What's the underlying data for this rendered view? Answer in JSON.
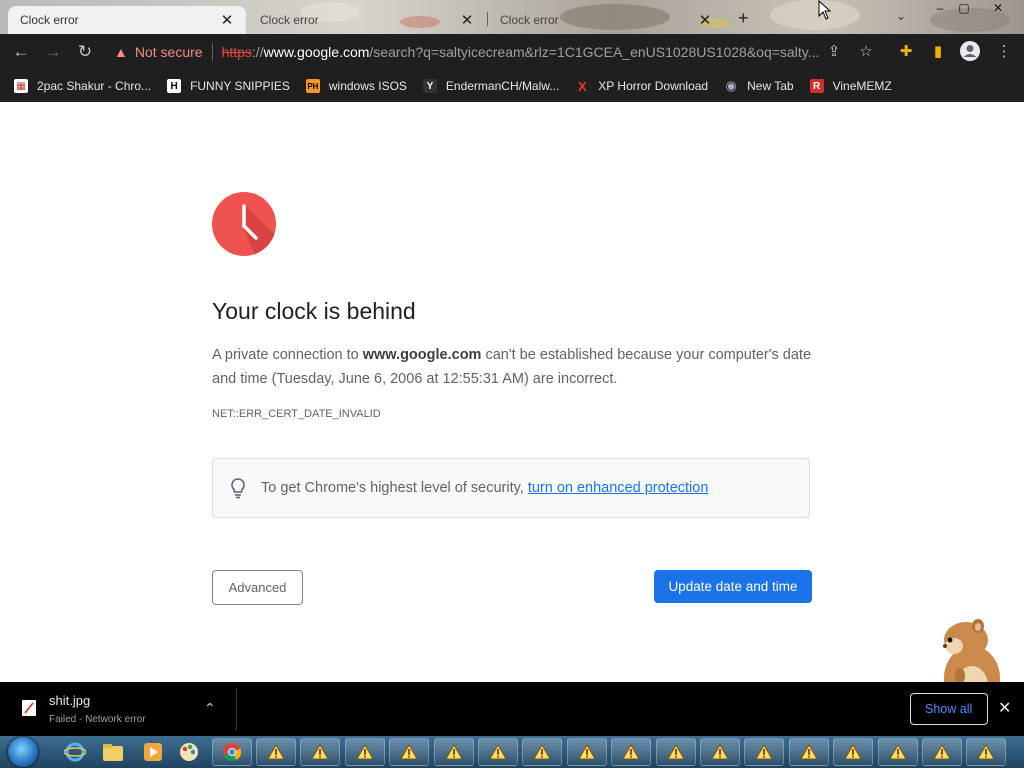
{
  "tabs": [
    {
      "title": "Clock error",
      "active": true,
      "close": "✕"
    },
    {
      "title": "Clock error",
      "active": false,
      "close": "✕"
    },
    {
      "title": "Clock error",
      "active": false,
      "close": "✕"
    }
  ],
  "new_tab_symbol": "+",
  "tab_search_symbol": "⌄",
  "window_controls": {
    "minimize": "‒",
    "maximize": "▢",
    "close": "✕"
  },
  "toolbar": {
    "back_icon": "←",
    "forward_icon": "→",
    "reload_icon": "↻",
    "warning_icon": "▲",
    "security_label": "Not secure",
    "url_scheme": "https",
    "url_slashes": "://",
    "url_host": "www.google.com",
    "url_path": "/search?q=saltyicecream&rlz=1C1GCEA_enUS1028US1028&oq=salty...",
    "share_icon": "⇪",
    "star_icon": "☆",
    "extensions_icon": "✚",
    "sidepanel_icon": "▮",
    "menu_icon": "⋮"
  },
  "bookmarks": [
    {
      "label": "2pac Shakur - Chro...",
      "icon": "▦",
      "icon_bg": "#ffffff",
      "icon_fg": "#c0392b"
    },
    {
      "label": "FUNNY SNIPPIES",
      "icon": "H",
      "icon_bg": "#ffffff",
      "icon_fg": "#000000"
    },
    {
      "label": "windows ISOS",
      "icon": "PH",
      "icon_bg": "#f7971d",
      "icon_fg": "#000000"
    },
    {
      "label": "EndermanCH/Malw...",
      "icon": "Y",
      "icon_bg": "#333333",
      "icon_fg": "#ffffff"
    },
    {
      "label": "XP Horror Download",
      "icon": "X",
      "icon_bg": "#1f1f1f",
      "icon_fg": "#e53935"
    },
    {
      "label": "New Tab",
      "icon": "◉",
      "icon_bg": "#1f1f1f",
      "icon_fg": "#b0a8c8"
    },
    {
      "label": "VineMEMZ",
      "icon": "R",
      "icon_bg": "#d32f2f",
      "icon_fg": "#ffffff"
    }
  ],
  "error_page": {
    "heading": "Your clock is behind",
    "desc_prefix": "A private connection to ",
    "desc_host": "www.google.com",
    "desc_suffix": " can't be established because your computer's date and time (Tuesday, June 6, 2006 at 12:55:31 AM) are incorrect.",
    "error_code": "NET::ERR_CERT_DATE_INVALID",
    "tip_text": "To get Chrome's highest level of security,",
    "tip_link": "turn on enhanced protection",
    "advanced_label": "Advanced",
    "update_label": "Update date and time",
    "clock_color": "#ef5350",
    "accent_color": "#1a73e8"
  },
  "download": {
    "filename": "shit.jpg",
    "status": "Failed - Network error",
    "chevron": "⌃",
    "show_all_label": "Show all",
    "close": "✕"
  },
  "taskbar": {
    "pinned": [
      "ie-icon",
      "explorer-icon",
      "media-player-icon",
      "paint-icon",
      "chrome-icon"
    ],
    "window_buttons": 17
  }
}
